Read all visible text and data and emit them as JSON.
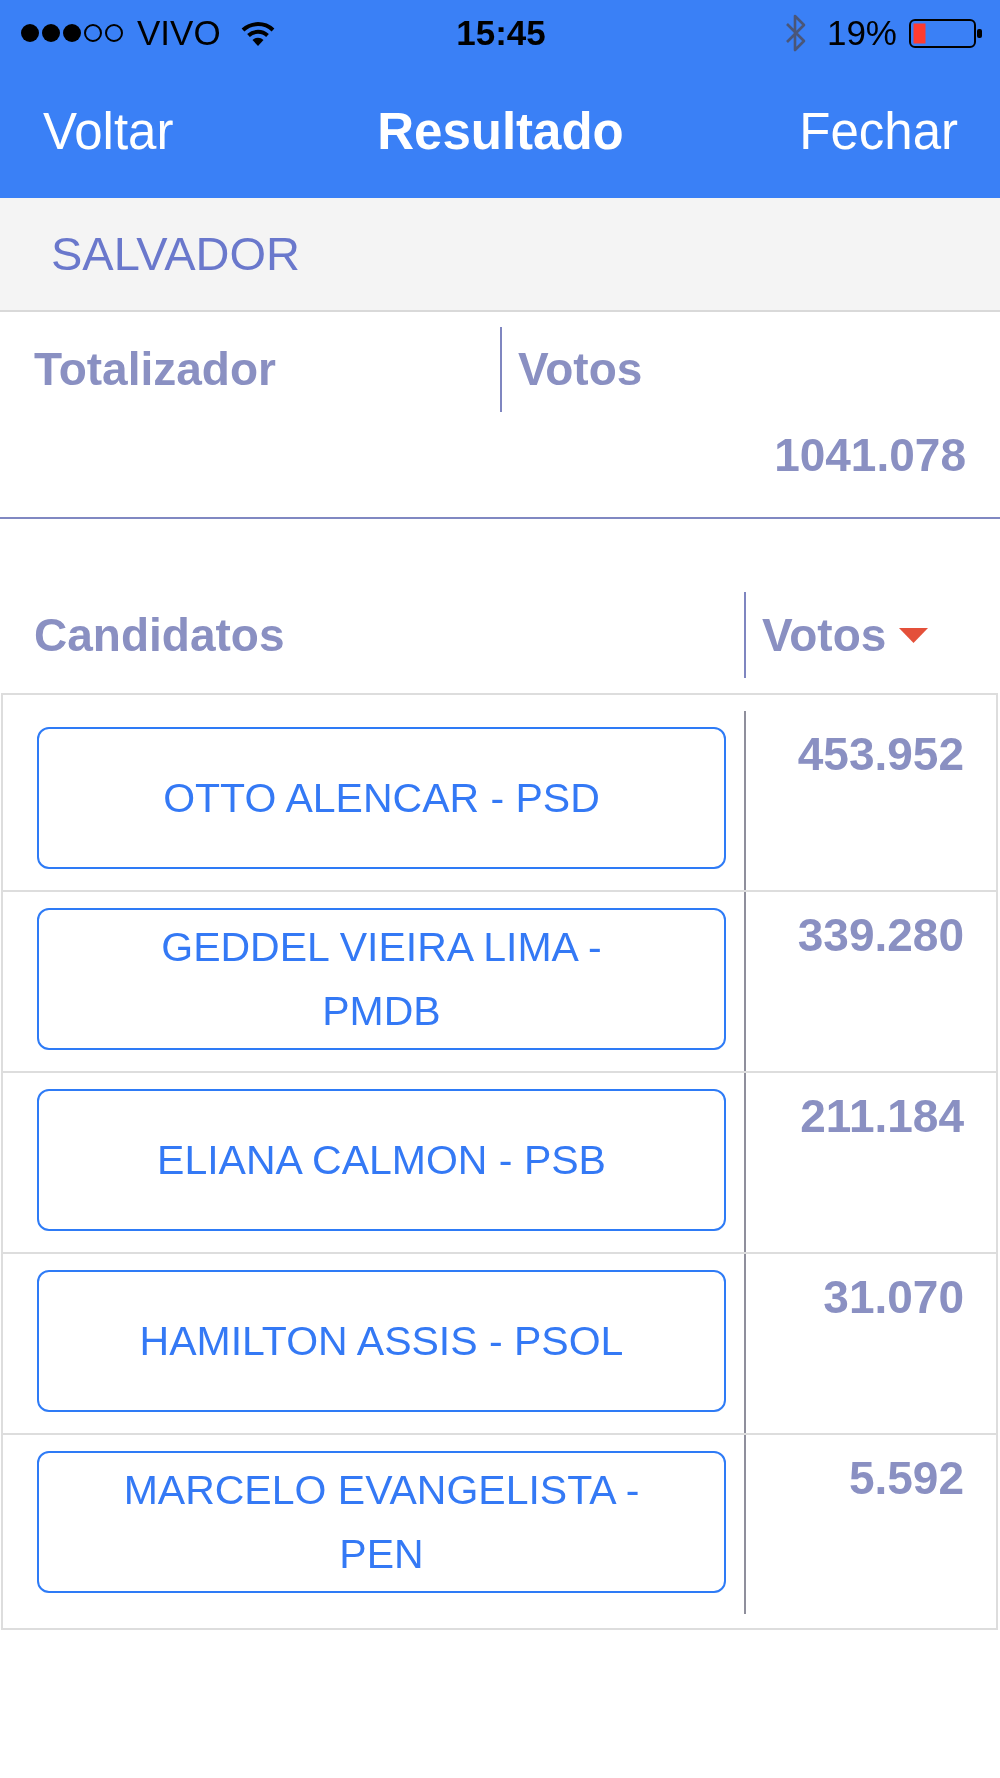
{
  "status_bar": {
    "carrier": "VIVO",
    "time": "15:45",
    "battery": "19%"
  },
  "nav_bar": {
    "back": "Voltar",
    "title": "Resultado",
    "close": "Fechar"
  },
  "city": {
    "name": "SALVADOR"
  },
  "totalizer": {
    "columns": [
      "Totalizador",
      "Votos"
    ],
    "total_votes": "1041.078"
  },
  "candidates": {
    "columns": [
      {
        "label": "Candidatos",
        "sort_descending": false
      },
      {
        "label": "Votos",
        "sort_descending": true
      }
    ],
    "rows": [
      {
        "name": "OTTO ALENCAR - PSD",
        "votes": "453.952"
      },
      {
        "name": "GEDDEL VIEIRA LIMA - PMDB",
        "votes": "339.280"
      },
      {
        "name": "ELIANA CALMON - PSB",
        "votes": "211.184"
      },
      {
        "name": "HAMILTON ASSIS - PSOL",
        "votes": "31.070"
      },
      {
        "name": "MARCELO EVANGELISTA - PEN",
        "votes": "5.592"
      }
    ]
  }
}
